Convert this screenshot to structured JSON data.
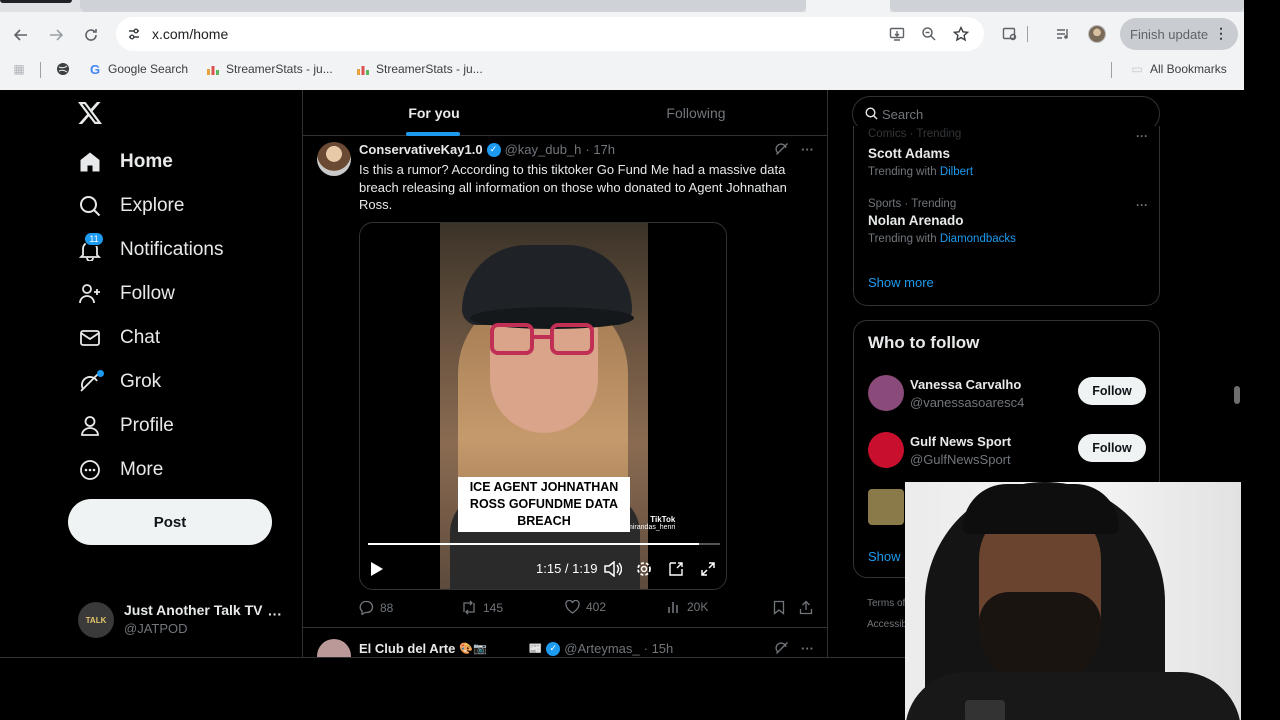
{
  "browser": {
    "url": "x.com/home",
    "finish_update": "Finish update",
    "bookmarks": [
      {
        "label": "Google Search",
        "icon": "google-icon"
      },
      {
        "label": "StreamerStats - ju...",
        "icon": "bar-chart-icon"
      },
      {
        "label": "StreamerStats - ju...",
        "icon": "bar-chart-icon"
      }
    ],
    "all_bookmarks": "All Bookmarks"
  },
  "nav": {
    "items": [
      {
        "label": "Home",
        "icon": "home-icon"
      },
      {
        "label": "Explore",
        "icon": "search-icon"
      },
      {
        "label": "Notifications",
        "icon": "bell-icon",
        "badge": "11"
      },
      {
        "label": "Follow",
        "icon": "add-person-icon"
      },
      {
        "label": "Chat",
        "icon": "mail-icon"
      },
      {
        "label": "Grok",
        "icon": "grok-icon"
      },
      {
        "label": "Profile",
        "icon": "person-icon"
      },
      {
        "label": "More",
        "icon": "more-circle-icon"
      }
    ],
    "post_label": "Post",
    "account": {
      "name": "Just Another Talk TV",
      "handle": "@JATPOD",
      "avatar_text": "TALK"
    }
  },
  "feed": {
    "tabs": [
      "For you",
      "Following"
    ],
    "tweet": {
      "name": "ConservativeKay1.0",
      "handle": "@kay_dub_h",
      "time": "· 17h",
      "text": "Is this a rumor? According to this tiktoker Go Fund Me had a massive data breach releasing all information on those who donated to Agent Johnathan Ross.",
      "video_caption": "ICE AGENT JOHNATHAN ROSS GOFUNDME DATA BREACH",
      "tiktok_mark": "TikTok",
      "tiktok_handle": "@ mirandas_henri",
      "time_readout": "1:15 / 1:19",
      "progress": 0.94,
      "stats": {
        "replies": "88",
        "reposts": "145",
        "likes": "402",
        "views": "20K"
      }
    },
    "tweet2": {
      "name": "El Club del Arte",
      "emojis": "🎨📷🎞🖼🏛📰",
      "handle": "@Arteymas_",
      "time": "· 15h"
    }
  },
  "sidebar": {
    "search_placeholder": "Search",
    "trends": [
      {
        "context": "Comics · Trending",
        "title": "Scott Adams",
        "with_label": "Trending with",
        "with": "Dilbert"
      },
      {
        "context": "Sports · Trending",
        "title": "Nolan Arenado",
        "with_label": "Trending with",
        "with": "Diamondbacks"
      }
    ],
    "show_more": "Show more",
    "who_to_follow": "Who to follow",
    "suggestions": [
      {
        "name": "Vanessa Carvalho",
        "handle": "@vanessasoaresc4",
        "button": "Follow",
        "avatar_color": "#8a4a7a"
      },
      {
        "name": "Gulf News Sport",
        "handle": "@GulfNewsSport",
        "button": "Follow",
        "avatar_color": "#c8102e"
      }
    ],
    "show_more_2": "Show",
    "footer": [
      "Terms of",
      "Accessib"
    ]
  },
  "colors": {
    "accent": "#1d9bf0",
    "background": "#000000",
    "text": "#e7e9ea",
    "muted": "#71767b"
  }
}
